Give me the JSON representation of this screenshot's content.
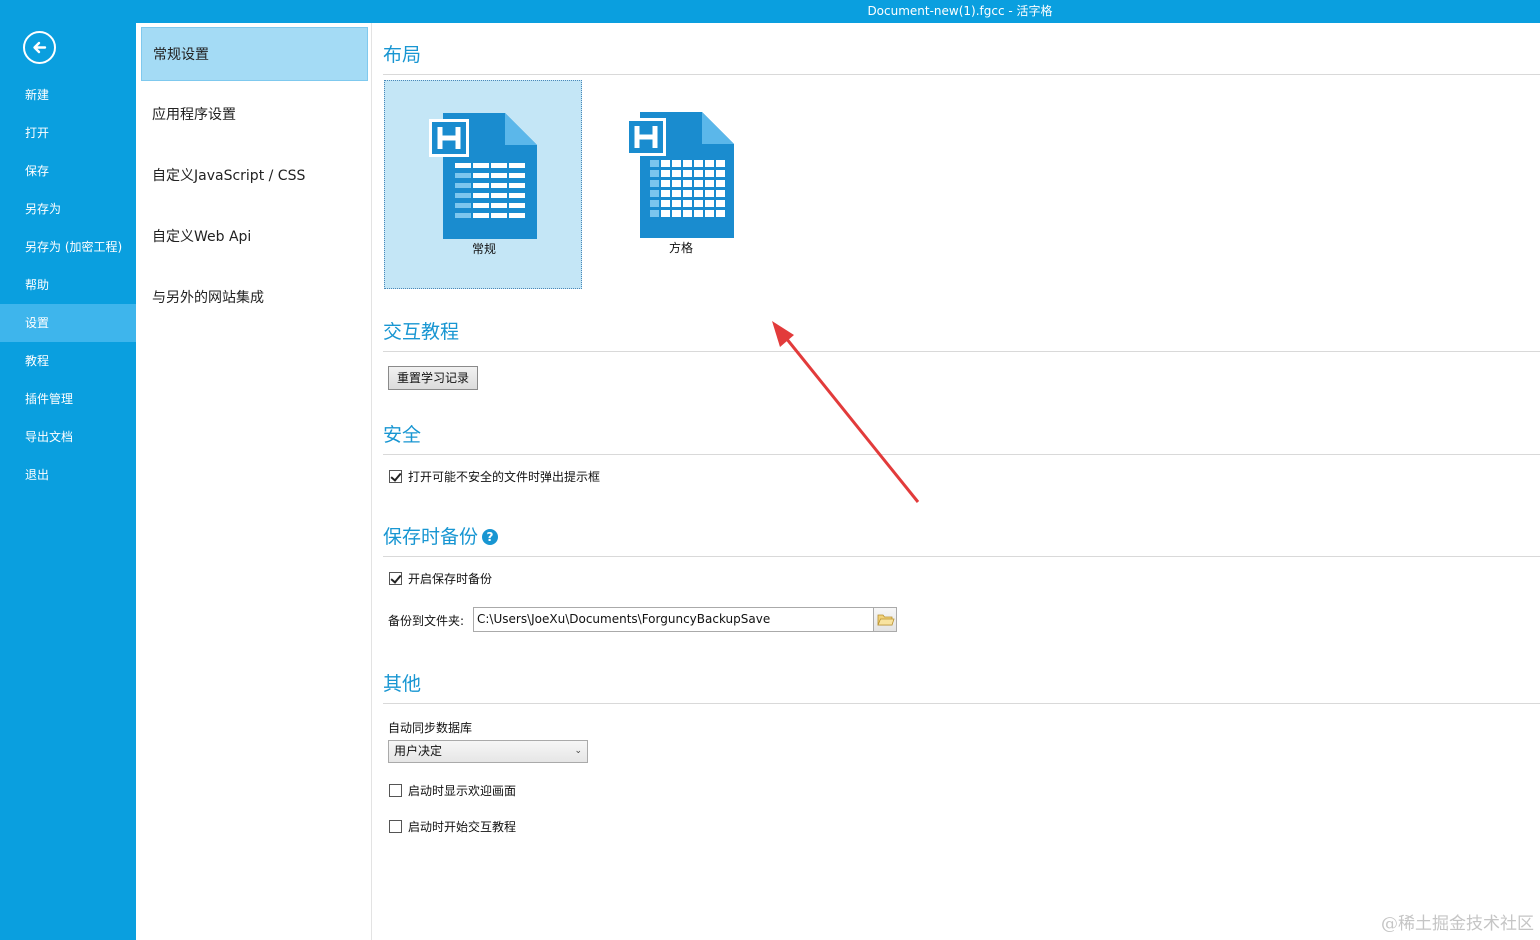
{
  "window": {
    "title": "Document-new(1).fgcc - 活字格"
  },
  "leftnav": {
    "back_icon": "back-arrow-icon",
    "items": [
      {
        "label": "新建"
      },
      {
        "label": "打开"
      },
      {
        "label": "保存"
      },
      {
        "label": "另存为"
      },
      {
        "label": "另存为 (加密工程)"
      },
      {
        "label": "帮助"
      },
      {
        "label": "设置"
      },
      {
        "label": "教程"
      },
      {
        "label": "插件管理"
      },
      {
        "label": "导出文档"
      },
      {
        "label": "退出"
      }
    ],
    "active": "设置"
  },
  "subnav": {
    "items": [
      {
        "label": "常规设置"
      },
      {
        "label": "应用程序设置"
      },
      {
        "label": "自定义JavaScript / CSS"
      },
      {
        "label": "自定义Web Api"
      },
      {
        "label": "与另外的网站集成"
      }
    ],
    "active": "常规设置"
  },
  "layout": {
    "title": "布局",
    "options": [
      {
        "label": "常规",
        "selected": true
      },
      {
        "label": "方格",
        "selected": false
      }
    ]
  },
  "tutorial": {
    "title": "交互教程",
    "reset_button": "重置学习记录"
  },
  "security": {
    "title": "安全",
    "warn_checkbox": {
      "label": "打开可能不安全的文件时弹出提示框",
      "checked": true
    }
  },
  "backup": {
    "title": "保存时备份",
    "help_icon": "question-circle-icon",
    "enable_checkbox": {
      "label": "开启保存时备份",
      "checked": true
    },
    "folder_label": "备份到文件夹:",
    "folder_value": "C:\\Users\\JoeXu\\Documents\\ForguncyBackupSave",
    "folder_icon": "folder-icon"
  },
  "other": {
    "title": "其他",
    "sync_label": "自动同步数据库",
    "sync_value": "用户决定",
    "welcome_checkbox": {
      "label": "启动时显示欢迎画面",
      "checked": false
    },
    "tutorial_checkbox": {
      "label": "启动时开始交互教程",
      "checked": false
    }
  },
  "watermark": "@稀土掘金技术社区",
  "colors": {
    "accent": "#0a9fdf",
    "nav_active": "#3eb5ec",
    "sub_active": "#a4dbf5",
    "section_title": "#1896d2",
    "annotation_arrow": "#e23b3b"
  }
}
